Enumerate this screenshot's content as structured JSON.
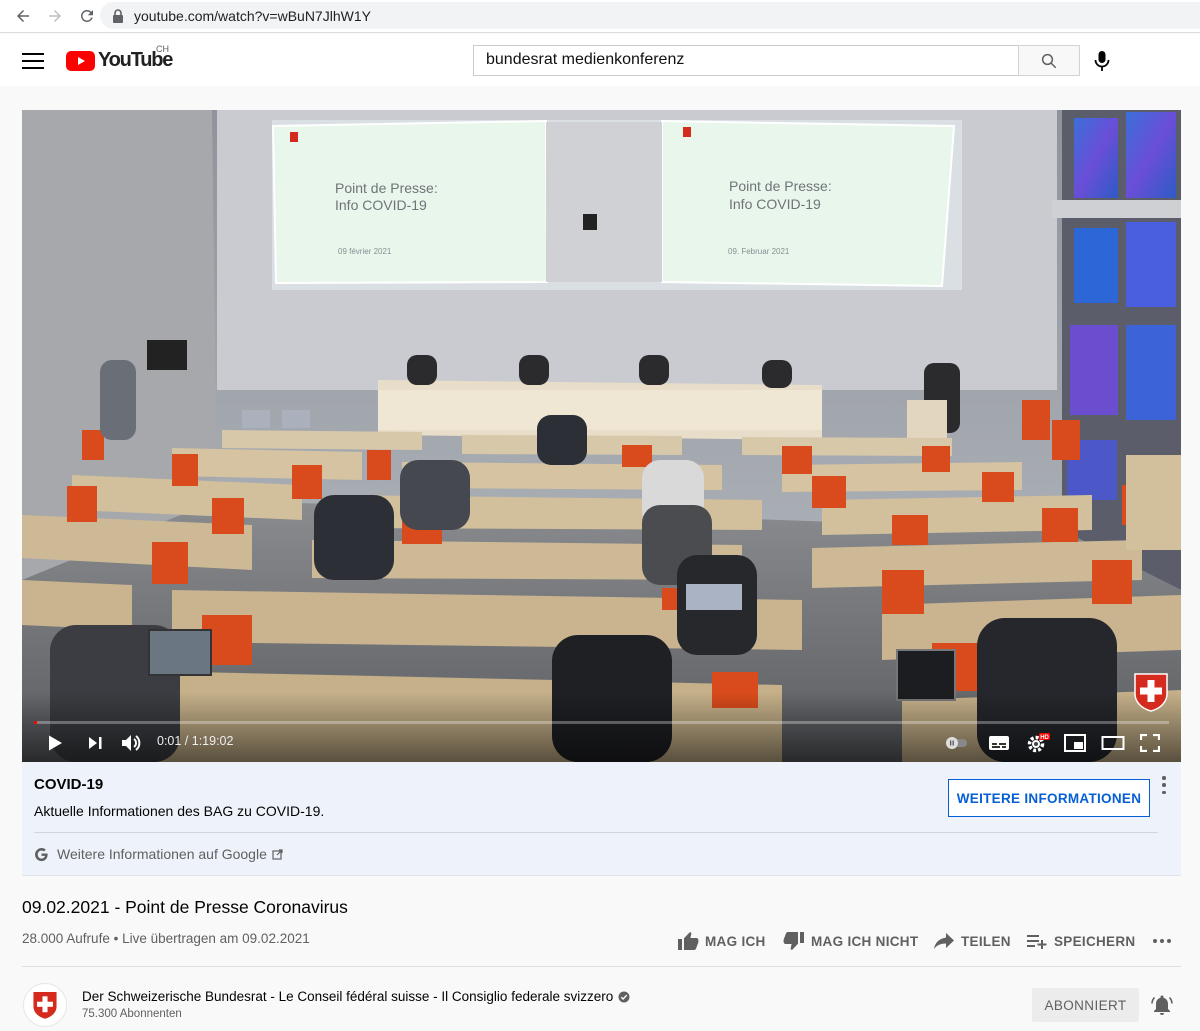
{
  "browser": {
    "url": "youtube.com/watch?v=wBuN7JlhW1Y"
  },
  "header": {
    "logo_text": "YouTube",
    "country_code": "CH",
    "search_value": "bundesrat medienkonferenz"
  },
  "player": {
    "time_current": "0:01",
    "time_total": "1:19:02",
    "time_display": "0:01 / 1:19:02",
    "progress_fraction": 0.0002,
    "screen_left": {
      "line1": "Point de Presse:",
      "line2": "Info COVID-19",
      "date": "09 février 2021"
    },
    "screen_right": {
      "line1": "Point de Presse:",
      "line2": "Info COVID-19",
      "date": "09. Februar 2021"
    }
  },
  "info_panel": {
    "title": "COVID-19",
    "text": "Aktuelle Informationen des BAG zu COVID-19.",
    "button_label": "WEITERE INFORMATIONEN",
    "link_label": "Weitere Informationen auf Google"
  },
  "video": {
    "title": "09.02.2021 - Point de Presse Coronavirus",
    "views": "28.000 Aufrufe",
    "separator": "•",
    "streamed": "Live übertragen am 09.02.2021",
    "like_label": "MAG ICH",
    "dislike_label": "MAG ICH NICHT",
    "share_label": "TEILEN",
    "save_label": "SPEICHERN"
  },
  "channel": {
    "name": "Der Schweizerische Bundesrat - Le Conseil fédéral suisse - Il Consiglio federale svizzero",
    "subscribers": "75.300 Abonnenten",
    "subscribe_label": "ABONNIERT"
  },
  "colors": {
    "brand_red": "#ff0000",
    "link_blue": "#065fd4",
    "swiss_red": "#d52b1e"
  },
  "icons": {
    "back": "arrow-left-icon",
    "forward": "arrow-right-icon",
    "reload": "reload-icon",
    "lock": "lock-icon",
    "menu": "hamburger-icon",
    "search": "search-icon",
    "mic": "microphone-icon",
    "play": "play-icon",
    "next": "skip-next-icon",
    "volume": "volume-icon",
    "autoplay": "autoplay-toggle-icon",
    "subtitles": "subtitles-icon",
    "settings": "gear-icon",
    "miniplayer": "miniplayer-icon",
    "theater": "theater-mode-icon",
    "fullscreen": "fullscreen-icon",
    "like": "thumbs-up-icon",
    "dislike": "thumbs-down-icon",
    "share": "share-icon",
    "save": "playlist-add-icon",
    "more": "more-horizontal-icon",
    "verified": "verified-check-icon",
    "bell": "bell-icon"
  }
}
